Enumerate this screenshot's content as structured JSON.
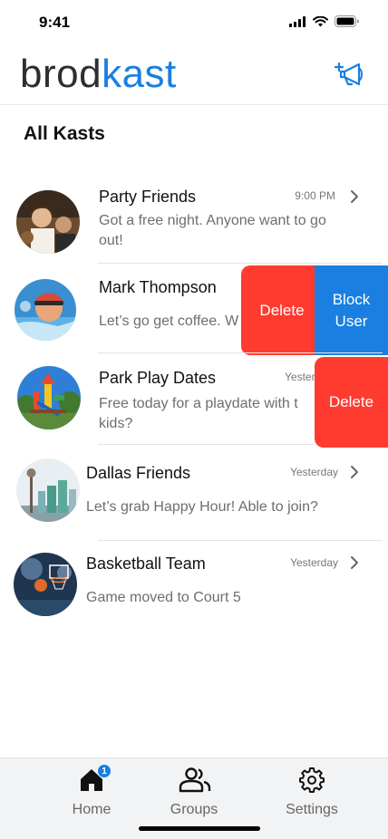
{
  "status_bar": {
    "time": "9:41"
  },
  "header": {
    "logo_part1": "brod",
    "logo_part2": "kast",
    "brand_color": "#1a7fe0"
  },
  "section_title": "All Kasts",
  "kasts": [
    {
      "name": "Party Friends",
      "time": "9:00 PM",
      "message": "Got a free night.  Anyone want to go out!"
    },
    {
      "name": "Mark Thompson",
      "time": "",
      "message": "Let’s go get coffee.  W"
    },
    {
      "name": "Park Play Dates",
      "time": "Yester",
      "message": "Free today for a playdate with t kids?"
    },
    {
      "name": "Dallas Friends",
      "time": "Yesterday",
      "message": "Let’s grab Happy Hour! Able to join?"
    },
    {
      "name": "Basketball Team",
      "time": "Yesterday",
      "message": "Game moved to Court 5"
    }
  ],
  "swipe_actions": {
    "row2_delete": "Delete",
    "row2_block_line1": "Block",
    "row2_block_line2": "User",
    "row3_delete": "Delete"
  },
  "tabs": [
    {
      "label": "Home",
      "icon": "home-icon",
      "badge": "1"
    },
    {
      "label": "Groups",
      "icon": "groups-icon"
    },
    {
      "label": "Settings",
      "icon": "gear-icon"
    }
  ],
  "colors": {
    "delete": "#ff3b30",
    "block": "#1a7fe0",
    "badge": "#1a7fe0"
  }
}
